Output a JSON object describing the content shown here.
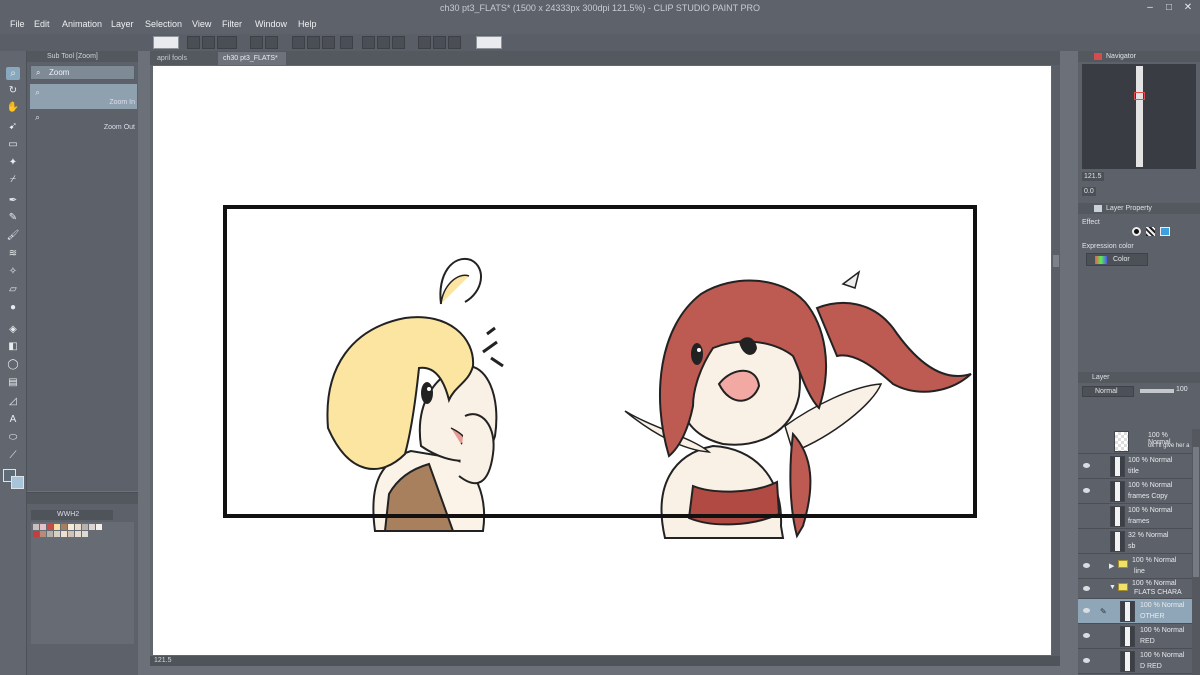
{
  "window": {
    "title": "ch30 pt3_FLATS* (1500 x 24333px 300dpi 121.5%)  - CLIP STUDIO PAINT PRO",
    "controls": [
      "–",
      "□",
      "✕"
    ]
  },
  "menu": [
    "File",
    "Edit",
    "Animation",
    "Layer",
    "Selection",
    "View",
    "Filter",
    "Window",
    "Help"
  ],
  "subtool": {
    "header": "Sub Tool [Zoom]",
    "group": "Zoom",
    "items": [
      "Zoom In",
      "Zoom Out"
    ]
  },
  "palette": {
    "name": "WWH2",
    "swatches": [
      "#c9c0bd",
      "#e3c3c5",
      "#c54e49",
      "#f6e0a2",
      "#a67f60",
      "#f6ead6",
      "#e8dccb",
      "#b8b1ad",
      "#ddd5cf",
      "#f3f0ea",
      "#c33e3c",
      "#b58b7a",
      "#b3b0aa",
      "#d8cfc4",
      "#ecdfd1",
      "#d2c2b6",
      "#e6dbd2",
      "#ddd9d3"
    ]
  },
  "document": {
    "tabs": [
      "april fools",
      "ch30 pt3_FLATS*"
    ],
    "zoom": "121.5"
  },
  "panels": {
    "navigator": {
      "title": "Navigator",
      "zoom": "121.5",
      "rotation": "0.0"
    },
    "layer_property": {
      "title": "Layer Property",
      "effect_label": "Effect",
      "expression_label": "Expression color",
      "expression_value": "Color"
    },
    "layer": {
      "title": "Layer",
      "blend_mode": "Normal",
      "opacity": "100",
      "rows": [
        {
          "opacity": "100 % Normal",
          "name": "ok I'll give her a"
        },
        {
          "opacity": "100 % Normal",
          "name": "title"
        },
        {
          "opacity": "100 % Normal",
          "name": "frames Copy"
        },
        {
          "opacity": "100 % Normal",
          "name": "frames"
        },
        {
          "opacity": "32 % Normal",
          "name": "sb"
        },
        {
          "opacity": "100 % Normal",
          "name": "line"
        },
        {
          "opacity": "100 % Normal",
          "name": "FLATS CHARA"
        },
        {
          "opacity": "100 % Normal",
          "name": "OTHER"
        },
        {
          "opacity": "100 % Normal",
          "name": "RED"
        },
        {
          "opacity": "100 % Normal",
          "name": "D RED"
        }
      ]
    }
  },
  "colors": {
    "hair_blonde": "#fbe5a0",
    "hair_red": "#bd5a52",
    "skin": "#faf1e6",
    "vest": "#a9805e",
    "sash": "#b04a43",
    "mouth": "#f2a9a4",
    "accent": "#88a9bd"
  }
}
